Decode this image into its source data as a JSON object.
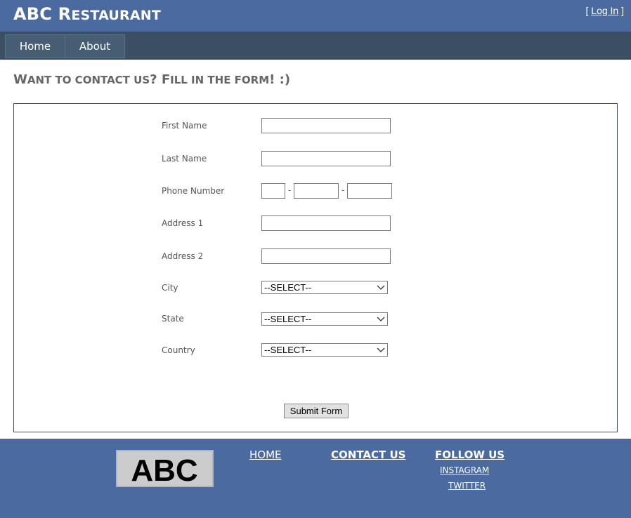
{
  "header": {
    "title_first": "ABC",
    "title_cap": "R",
    "title_rest": "ESTAURANT",
    "login_open": "[ ",
    "login_label": "Log In",
    "login_close": " ]"
  },
  "nav": {
    "items": [
      {
        "label": "Home"
      },
      {
        "label": "About"
      }
    ]
  },
  "page": {
    "heading_parts": [
      "W",
      "ANT TO CONTACT US",
      "? F",
      "ILL IN THE FORM",
      "! :)"
    ]
  },
  "form": {
    "first_name_label": "First Name",
    "last_name_label": "Last Name",
    "phone_label": "Phone Number",
    "phone_separator": "-",
    "address1_label": "Address 1",
    "address2_label": "Address 2",
    "city_label": "City",
    "state_label": "State",
    "country_label": "Country",
    "city_selected": "--SELECT--",
    "state_selected": "--SELECT--",
    "country_selected": "--SELECT--",
    "submit_label": "Submit Form"
  },
  "footer": {
    "logo_text": "ABC",
    "home_link": "HOME",
    "contact_link": "CONTACT US",
    "follow_heading": "FOLLOW US",
    "instagram_link": "INSTAGRAM",
    "twitter_link": "TWITTER"
  },
  "colors": {
    "header_bg": "#4a6aa0",
    "nav_bg": "#3c4f62",
    "heading_text": "#666666"
  },
  "icons": {
    "select_arrow": "chevron-down-icon"
  }
}
